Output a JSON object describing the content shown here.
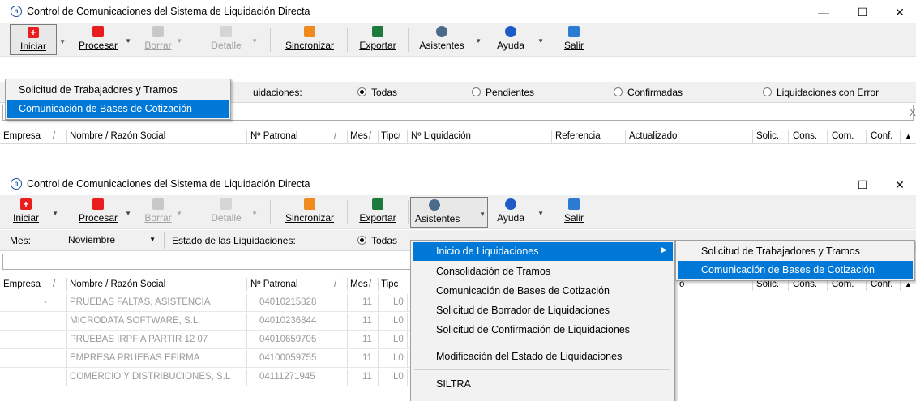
{
  "window": {
    "title": "Control de Comunicaciones del Sistema de Liquidación Directa",
    "minimize": "—",
    "maximize": "☐",
    "close": "✕"
  },
  "toolbar": {
    "iniciar": "Iniciar",
    "procesar": "Procesar",
    "borrar": "Borrar",
    "detalle": "Detalle",
    "sincronizar": "Sincronizar",
    "exportar": "Exportar",
    "asistentes": "Asistentes",
    "ayuda": "Ayuda",
    "salir": "Salir"
  },
  "filter": {
    "mes_label": "Mes:",
    "mes_value": "Noviembre",
    "estado_label": "Estado de las Liquidaciones:",
    "estado_label_partial": "uidaciones:",
    "todas": "Todas",
    "pendientes": "Pendientes",
    "confirmadas": "Confirmadas",
    "con_error": "Liquidaciones con Error"
  },
  "columns": {
    "empresa": "Empresa",
    "nombre": "Nombre / Razón Social",
    "patronal": "Nº Patronal",
    "mes": "Mes",
    "tipo": "Tipc",
    "liquidacion": "Nº Liquidación",
    "referencia": "Referencia",
    "actualizado": "Actualizado",
    "solic": "Solic.",
    "cons": "Cons.",
    "com": "Com.",
    "conf": "Conf.",
    "sort_mark": "/",
    "search_clear": "X"
  },
  "iniciar_menu": {
    "items": [
      "Solicitud de Trabajadores y Tramos",
      "Comunicación de Bases de Cotización"
    ],
    "highlighted_index": 1
  },
  "asistentes_menu": {
    "items": [
      "Inicio de Liquidaciones",
      "Consolidación de Tramos",
      "Comunicación de Bases de Cotización",
      "Solicitud de Borrador de Liquidaciones",
      "Solicitud de Confirmación de Liquidaciones",
      "Modificación del  Estado de Liquidaciones",
      "SILTRA"
    ],
    "highlighted_index": 0
  },
  "inicio_submenu": {
    "items": [
      "Solicitud de Trabajadores y Tramos",
      "Comunicación de Bases de Cotización"
    ],
    "highlighted_index": 1
  },
  "rows": [
    {
      "empresa": "-",
      "nombre": "PRUEBAS FALTAS, ASISTENCIA",
      "patronal": "04010215828",
      "mes": "11",
      "tipo": "L0"
    },
    {
      "empresa": "",
      "nombre": "MICRODATA SOFTWARE, S.L.",
      "patronal": "04010236844",
      "mes": "11",
      "tipo": "L0"
    },
    {
      "empresa": "",
      "nombre": "PRUEBAS IRPF A PARTIR 12 07",
      "patronal": "04010659705",
      "mes": "11",
      "tipo": "L0"
    },
    {
      "empresa": "",
      "nombre": "EMPRESA PRUEBAS EFIRMA",
      "patronal": "04100059755",
      "mes": "11",
      "tipo": "L0"
    },
    {
      "empresa": "",
      "nombre": "COMERCIO Y DISTRIBUCIONES, S.L",
      "patronal": "04111271945",
      "mes": "11",
      "tipo": "L0"
    }
  ],
  "colors": {
    "highlight": "#0078d7",
    "toolbar_bg": "#f0f0f0",
    "green_corner": "#1db24f"
  }
}
